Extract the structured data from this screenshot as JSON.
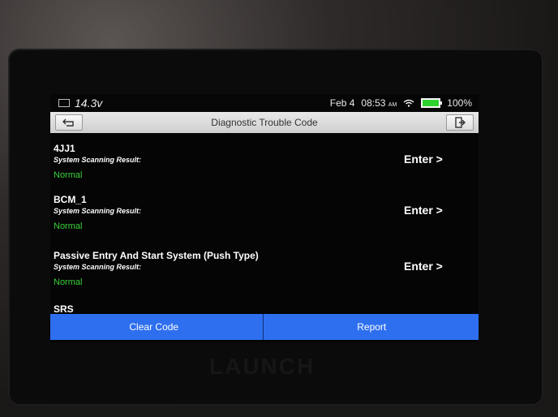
{
  "status_bar": {
    "voltage": "14.3v",
    "date": "Feb 4",
    "time": "08:53",
    "ampm": "AM",
    "battery": "100%"
  },
  "titlebar": {
    "title": "Diagnostic Trouble Code"
  },
  "systems": [
    {
      "name": "4JJ1",
      "label": "System Scanning Result:",
      "status": "Normal",
      "action": "Enter >"
    },
    {
      "name": "BCM_1",
      "label": "System Scanning Result:",
      "status": "Normal",
      "action": "Enter >"
    },
    {
      "name": "Passive Entry And Start System (Push Type)",
      "label": "System Scanning Result:",
      "status": "Normal",
      "action": "Enter >"
    },
    {
      "name": "SRS",
      "label": "",
      "status": "",
      "action": ""
    }
  ],
  "actions": {
    "clear_code": "Clear Code",
    "report": "Report"
  },
  "brand": "LAUNCH",
  "colors": {
    "accent_blue": "#2e6ff0",
    "status_green": "#39d239"
  }
}
